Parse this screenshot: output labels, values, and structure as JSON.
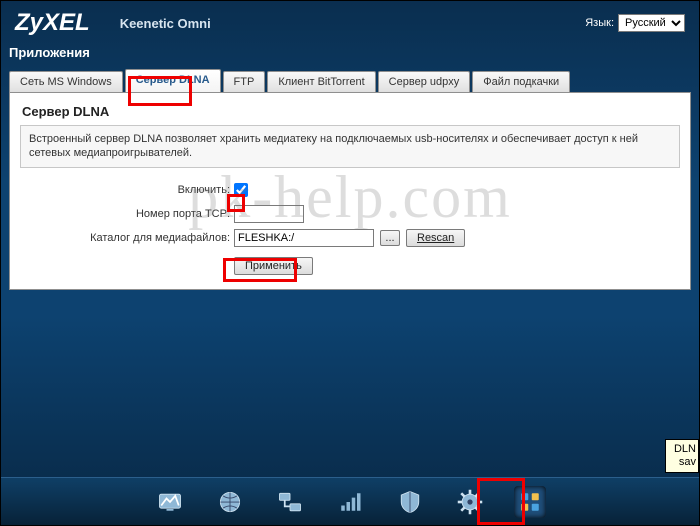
{
  "brand": "ZyXEL",
  "product": "Keenetic Omni",
  "language": {
    "label": "Язык:",
    "selected": "Русский"
  },
  "section": "Приложения",
  "tabs": [
    {
      "label": "Сеть MS Windows"
    },
    {
      "label": "Сервер DLNA"
    },
    {
      "label": "FTP"
    },
    {
      "label": "Клиент BitTorrent"
    },
    {
      "label": "Сервер udpxy"
    },
    {
      "label": "Файл подкачки"
    }
  ],
  "panel": {
    "title": "Сервер DLNA",
    "description": "Встроенный сервер DLNA позволяет хранить медиатеку на подключаемых usb-носителях и обеспечивает доступ к ней сетевых медиапроигрывателей.",
    "rows": {
      "enable_label": "Включить:",
      "port_label": "Номер порта TCP:",
      "port_value": "",
      "dir_label": "Каталог для медиафайлов:",
      "dir_value": "FLESHKA:/",
      "browse_btn": "...",
      "rescan_btn": "Rescan",
      "apply_btn": "Применить"
    }
  },
  "watermark": "pk-help.com",
  "tooltip": {
    "line1": "DLN",
    "line2": "sav"
  },
  "bottom_icons": [
    "monitor-icon",
    "globe-icon",
    "network-icon",
    "signal-icon",
    "shield-icon",
    "gear-icon",
    "apps-icon"
  ]
}
